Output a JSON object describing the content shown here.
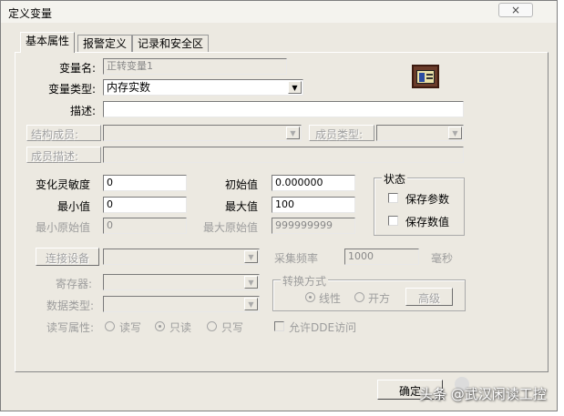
{
  "window": {
    "title": "定义变量",
    "close_label": "×"
  },
  "tabs": [
    {
      "label": "基本属性"
    },
    {
      "label": "报警定义"
    },
    {
      "label": "记录和安全区"
    }
  ],
  "basic": {
    "var_name_label": "变量名:",
    "var_name_value": "正转变量1",
    "var_type_label": "变量类型:",
    "var_type_value": "内存实数",
    "desc_label": "描述:",
    "desc_value": "",
    "struct_member_label": "结构成员:",
    "member_type_label": "成员类型:",
    "member_desc_label": "成员描述:",
    "sensitivity_label": "变化灵敏度",
    "sensitivity_value": "0",
    "initial_label": "初始值",
    "initial_value": "0.000000",
    "min_label": "最小值",
    "min_value": "0",
    "max_label": "最大值",
    "max_value": "100",
    "min_raw_label": "最小原始值",
    "min_raw_value": "0",
    "max_raw_label": "最大原始值",
    "max_raw_value": "999999999"
  },
  "state_group": {
    "title": "状态",
    "save_params_label": "保存参数",
    "save_value_label": "保存数值"
  },
  "io": {
    "connect_device_label": "连接设备",
    "register_label": "寄存器:",
    "data_type_label": "数据类型:",
    "rw_label": "读写属性:",
    "rw_options": [
      "读写",
      "只读",
      "只写"
    ],
    "rw_selected": "只读",
    "sample_freq_label": "采集频率",
    "sample_freq_value": "1000",
    "sample_freq_unit": "毫秒",
    "convert_group_title": "转换方式",
    "convert_options": [
      "线性",
      "开方"
    ],
    "convert_selected": "线性",
    "advanced_label": "高级",
    "dde_label": "允许DDE访问"
  },
  "footer": {
    "ok_label": "确定"
  },
  "watermark": {
    "text": "头条 @武汉闲读工控"
  }
}
